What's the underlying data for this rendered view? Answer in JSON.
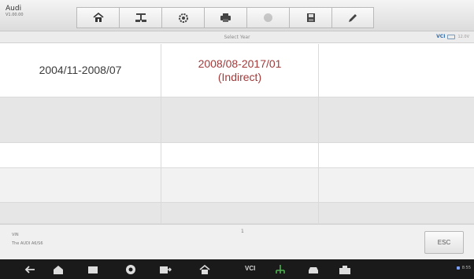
{
  "header": {
    "make": "Audi",
    "version": "V1.00.00"
  },
  "toolbar": {
    "tools": [
      {
        "name": "home-icon",
        "enabled": true
      },
      {
        "name": "vehicle-swap-icon",
        "enabled": true
      },
      {
        "name": "settings-icon",
        "enabled": true
      },
      {
        "name": "print-icon",
        "enabled": true
      },
      {
        "name": "help-icon",
        "enabled": false
      },
      {
        "name": "save-icon",
        "enabled": true
      },
      {
        "name": "edit-icon",
        "enabled": true
      }
    ]
  },
  "status": {
    "title": "Select Year",
    "vci": "VCI",
    "battery": "12.0V"
  },
  "options": {
    "opt1": "2004/11-2008/07",
    "opt2_line1": "2008/08-2017/01",
    "opt2_line2": "(Indirect)"
  },
  "info": {
    "vin_label": "VIN",
    "vin_value": "The AUDI A6/S6",
    "page_mark": "1",
    "esc_label": "ESC"
  },
  "navbar": {
    "vci_label": "VCI",
    "clock": "8:55"
  },
  "colors": {
    "highlight": "#a23a3a",
    "vci_blue": "#2b6db0"
  }
}
